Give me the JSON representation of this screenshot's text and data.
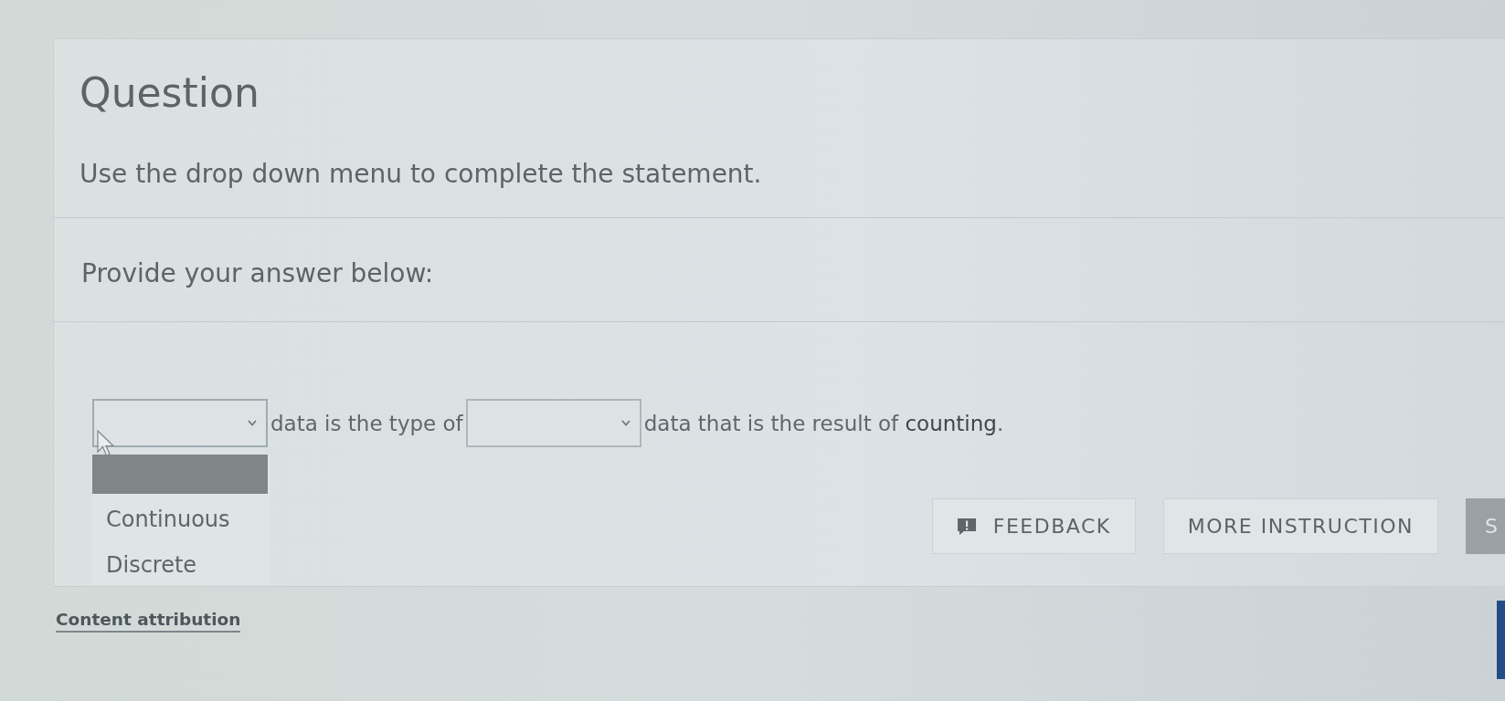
{
  "question": {
    "title": "Question",
    "instruction": "Use the drop down menu to complete the statement."
  },
  "answer_prompt": "Provide your answer below:",
  "statement": [
    {
      "kind": "dropdown",
      "expanded": true,
      "options": [
        {
          "kind": "blank",
          "highlighted": true
        },
        {
          "kind": "option",
          "label": "Continuous",
          "highlighted": false
        },
        {
          "kind": "option",
          "label": "Discrete",
          "highlighted": false
        }
      ]
    },
    {
      "kind": "text",
      "text": "data is the type of"
    },
    {
      "kind": "dropdown",
      "expanded": false
    },
    {
      "kind": "text",
      "text": "data that is the result of **counting**."
    }
  ],
  "buttons": [
    {
      "kind": "feedback",
      "label": "FEEDBACK"
    },
    {
      "kind": "plain",
      "label": "MORE INSTRUCTION"
    },
    {
      "kind": "primary",
      "label": "S"
    }
  ],
  "footer_link": "Content attribution"
}
